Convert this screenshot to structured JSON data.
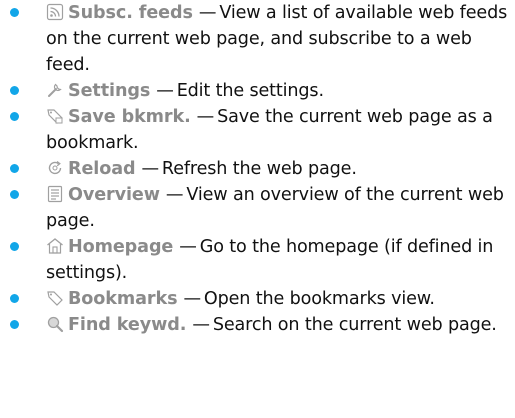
{
  "items": [
    {
      "icon": "rss-feed-icon",
      "title": "Subsc. feeds",
      "desc": "View a list of available web feeds on the current web page, and subscribe to a web feed."
    },
    {
      "icon": "wrench-icon",
      "title": "Settings",
      "desc": "Edit the settings."
    },
    {
      "icon": "save-bookmark-icon",
      "title": "Save bkmrk.",
      "desc": "Save the current web page as a bookmark."
    },
    {
      "icon": "reload-icon",
      "title": "Reload",
      "desc": "Refresh the web page."
    },
    {
      "icon": "overview-icon",
      "title": "Overview",
      "desc": "View an overview of the current web page."
    },
    {
      "icon": "home-icon",
      "title": "Homepage",
      "desc": "Go to the homepage (if defined in settings)."
    },
    {
      "icon": "bookmark-icon",
      "title": "Bookmarks",
      "desc": "Open the bookmarks view."
    },
    {
      "icon": "search-icon",
      "title": "Find keywd.",
      "desc": "Search on the current web page."
    }
  ],
  "dash": "—",
  "colors": {
    "bullet": "#12a6e8",
    "title": "#8a8a8a",
    "text": "#111111"
  }
}
